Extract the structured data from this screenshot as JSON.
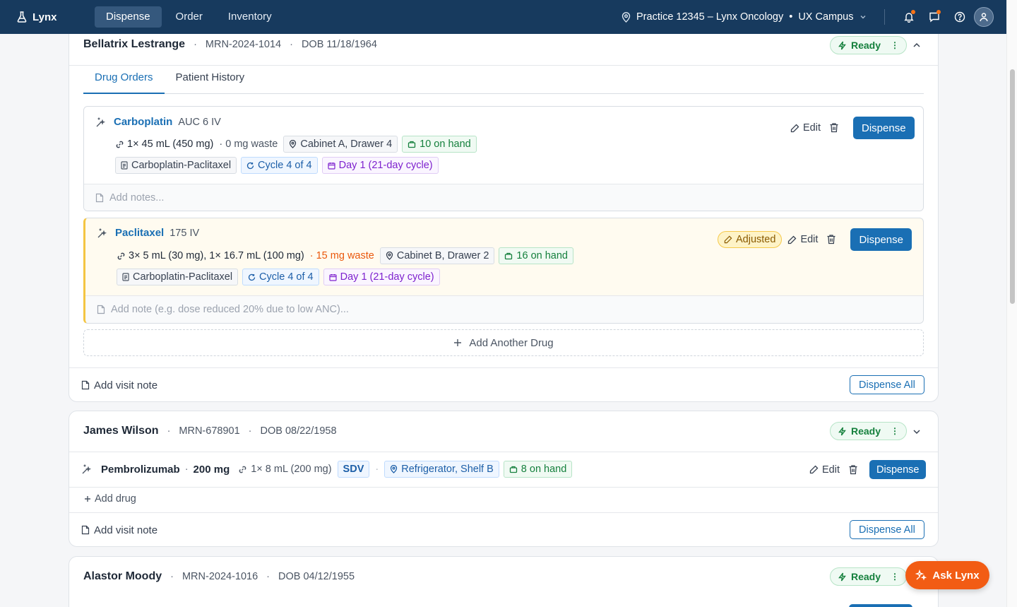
{
  "app": {
    "name": "Lynx"
  },
  "nav": {
    "items": [
      "Dispense",
      "Order",
      "Inventory"
    ],
    "active": "Dispense"
  },
  "practice": {
    "label": "Practice 12345 – Lynx Oncology",
    "campus": "UX Campus"
  },
  "patients": [
    {
      "name": "Bellatrix Lestrange",
      "mrn": "MRN-2024-1014",
      "dob": "DOB 11/18/1964",
      "status": "Ready",
      "tabs": [
        "Drug Orders",
        "Patient History"
      ],
      "drugs": [
        {
          "name": "Carboplatin",
          "dose": "AUC 6 IV",
          "vials": "1× 45 mL (450 mg)",
          "waste": "· 0 mg waste",
          "location": "Cabinet A, Drawer 4",
          "on_hand": "10 on hand",
          "regimen": "Carboplatin-Paclitaxel",
          "cycle": "Cycle 4 of 4",
          "day": "Day 1 (21-day cycle)",
          "notes_placeholder": "Add notes...",
          "edit_label": "Edit",
          "dispense_label": "Dispense"
        },
        {
          "name": "Paclitaxel",
          "dose": "175 IV",
          "vials": "3× 5 mL (30 mg), 1× 16.7 mL (100 mg)",
          "waste": "· 15 mg waste",
          "location": "Cabinet B, Drawer 2",
          "on_hand": "16 on hand",
          "regimen": "Carboplatin-Paclitaxel",
          "cycle": "Cycle 4 of 4",
          "day": "Day 1 (21-day cycle)",
          "badge": "Adjusted",
          "notes_placeholder": "Add note (e.g. dose reduced 20% due to low ANC)...",
          "edit_label": "Edit",
          "dispense_label": "Dispense"
        }
      ],
      "add_drug_label": "Add Another Drug",
      "visit_note_label": "Add visit note",
      "dispense_all_label": "Dispense All"
    },
    {
      "name": "James Wilson",
      "mrn": "MRN-678901",
      "dob": "DOB 08/22/1958",
      "status": "Ready",
      "drug": {
        "name": "Pembrolizumab",
        "dose": "200 mg",
        "vials": "1× 8 mL (200 mg)",
        "tag": "SDV",
        "location": "Refrigerator, Shelf B",
        "on_hand": "8 on hand",
        "edit_label": "Edit",
        "dispense_label": "Dispense"
      },
      "add_drug_label": "Add drug",
      "visit_note_label": "Add visit note",
      "dispense_all_label": "Dispense All"
    },
    {
      "name": "Alastor Moody",
      "mrn": "MRN-2024-1016",
      "dob": "DOB 04/12/1955",
      "status": "Ready"
    }
  ],
  "fab": {
    "label": "Ask Lynx"
  },
  "colors": {
    "nav_bg": "#173a5e",
    "primary": "#1a6fb4",
    "ready": "#15803d",
    "warning": "#f97316",
    "fab": "#f25c14"
  }
}
